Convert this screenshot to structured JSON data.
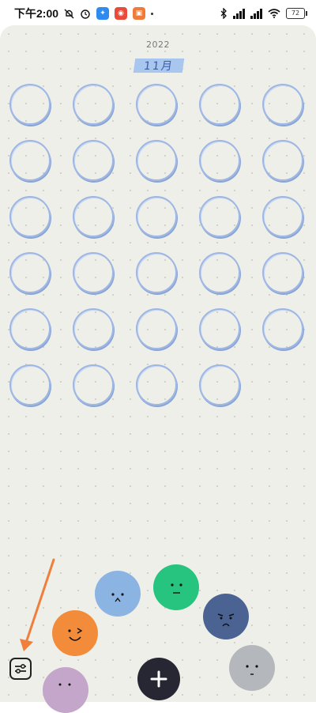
{
  "status_bar": {
    "time": "下午2:00",
    "battery": "72"
  },
  "calendar": {
    "year": "2022",
    "month": "11月",
    "day_count": 29
  },
  "mood_colors": {
    "purple": "#c3a6c9",
    "orange": "#f28c3b",
    "light_blue": "#8cb4e3",
    "green": "#27c47f",
    "navy": "#4a6393",
    "grey": "#b4b7bb"
  },
  "icons": {
    "filter": "sliders-icon",
    "add": "plus-icon"
  }
}
